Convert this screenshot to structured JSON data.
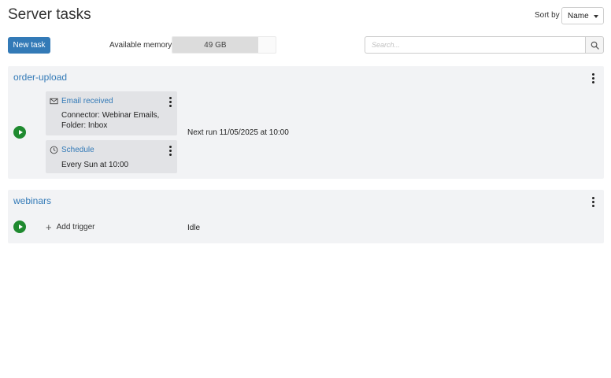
{
  "header": {
    "title": "Server tasks",
    "sort_label": "Sort by",
    "sort_value": "Name"
  },
  "toolbar": {
    "new_task_label": "New task",
    "memory_label": "Available memory",
    "memory_value": "49 GB",
    "memory_fraction": 0.83,
    "search_placeholder": "Search..."
  },
  "tasks": [
    {
      "name": "order-upload",
      "status": "Next run 11/05/2025 at 10:00",
      "triggers": [
        {
          "icon": "envelope-icon",
          "title": "Email received",
          "detail": "Connector: Webinar Emails, Folder: Inbox"
        },
        {
          "icon": "clock-icon",
          "title": "Schedule",
          "detail": "Every Sun at 10:00"
        }
      ]
    },
    {
      "name": "webinars",
      "status": "Idle",
      "add_trigger_label": "Add trigger"
    }
  ],
  "colors": {
    "accent": "#337ab7",
    "run": "#1f8a2f",
    "card_bg": "#f2f3f5",
    "trigger_bg": "#e2e3e6"
  }
}
